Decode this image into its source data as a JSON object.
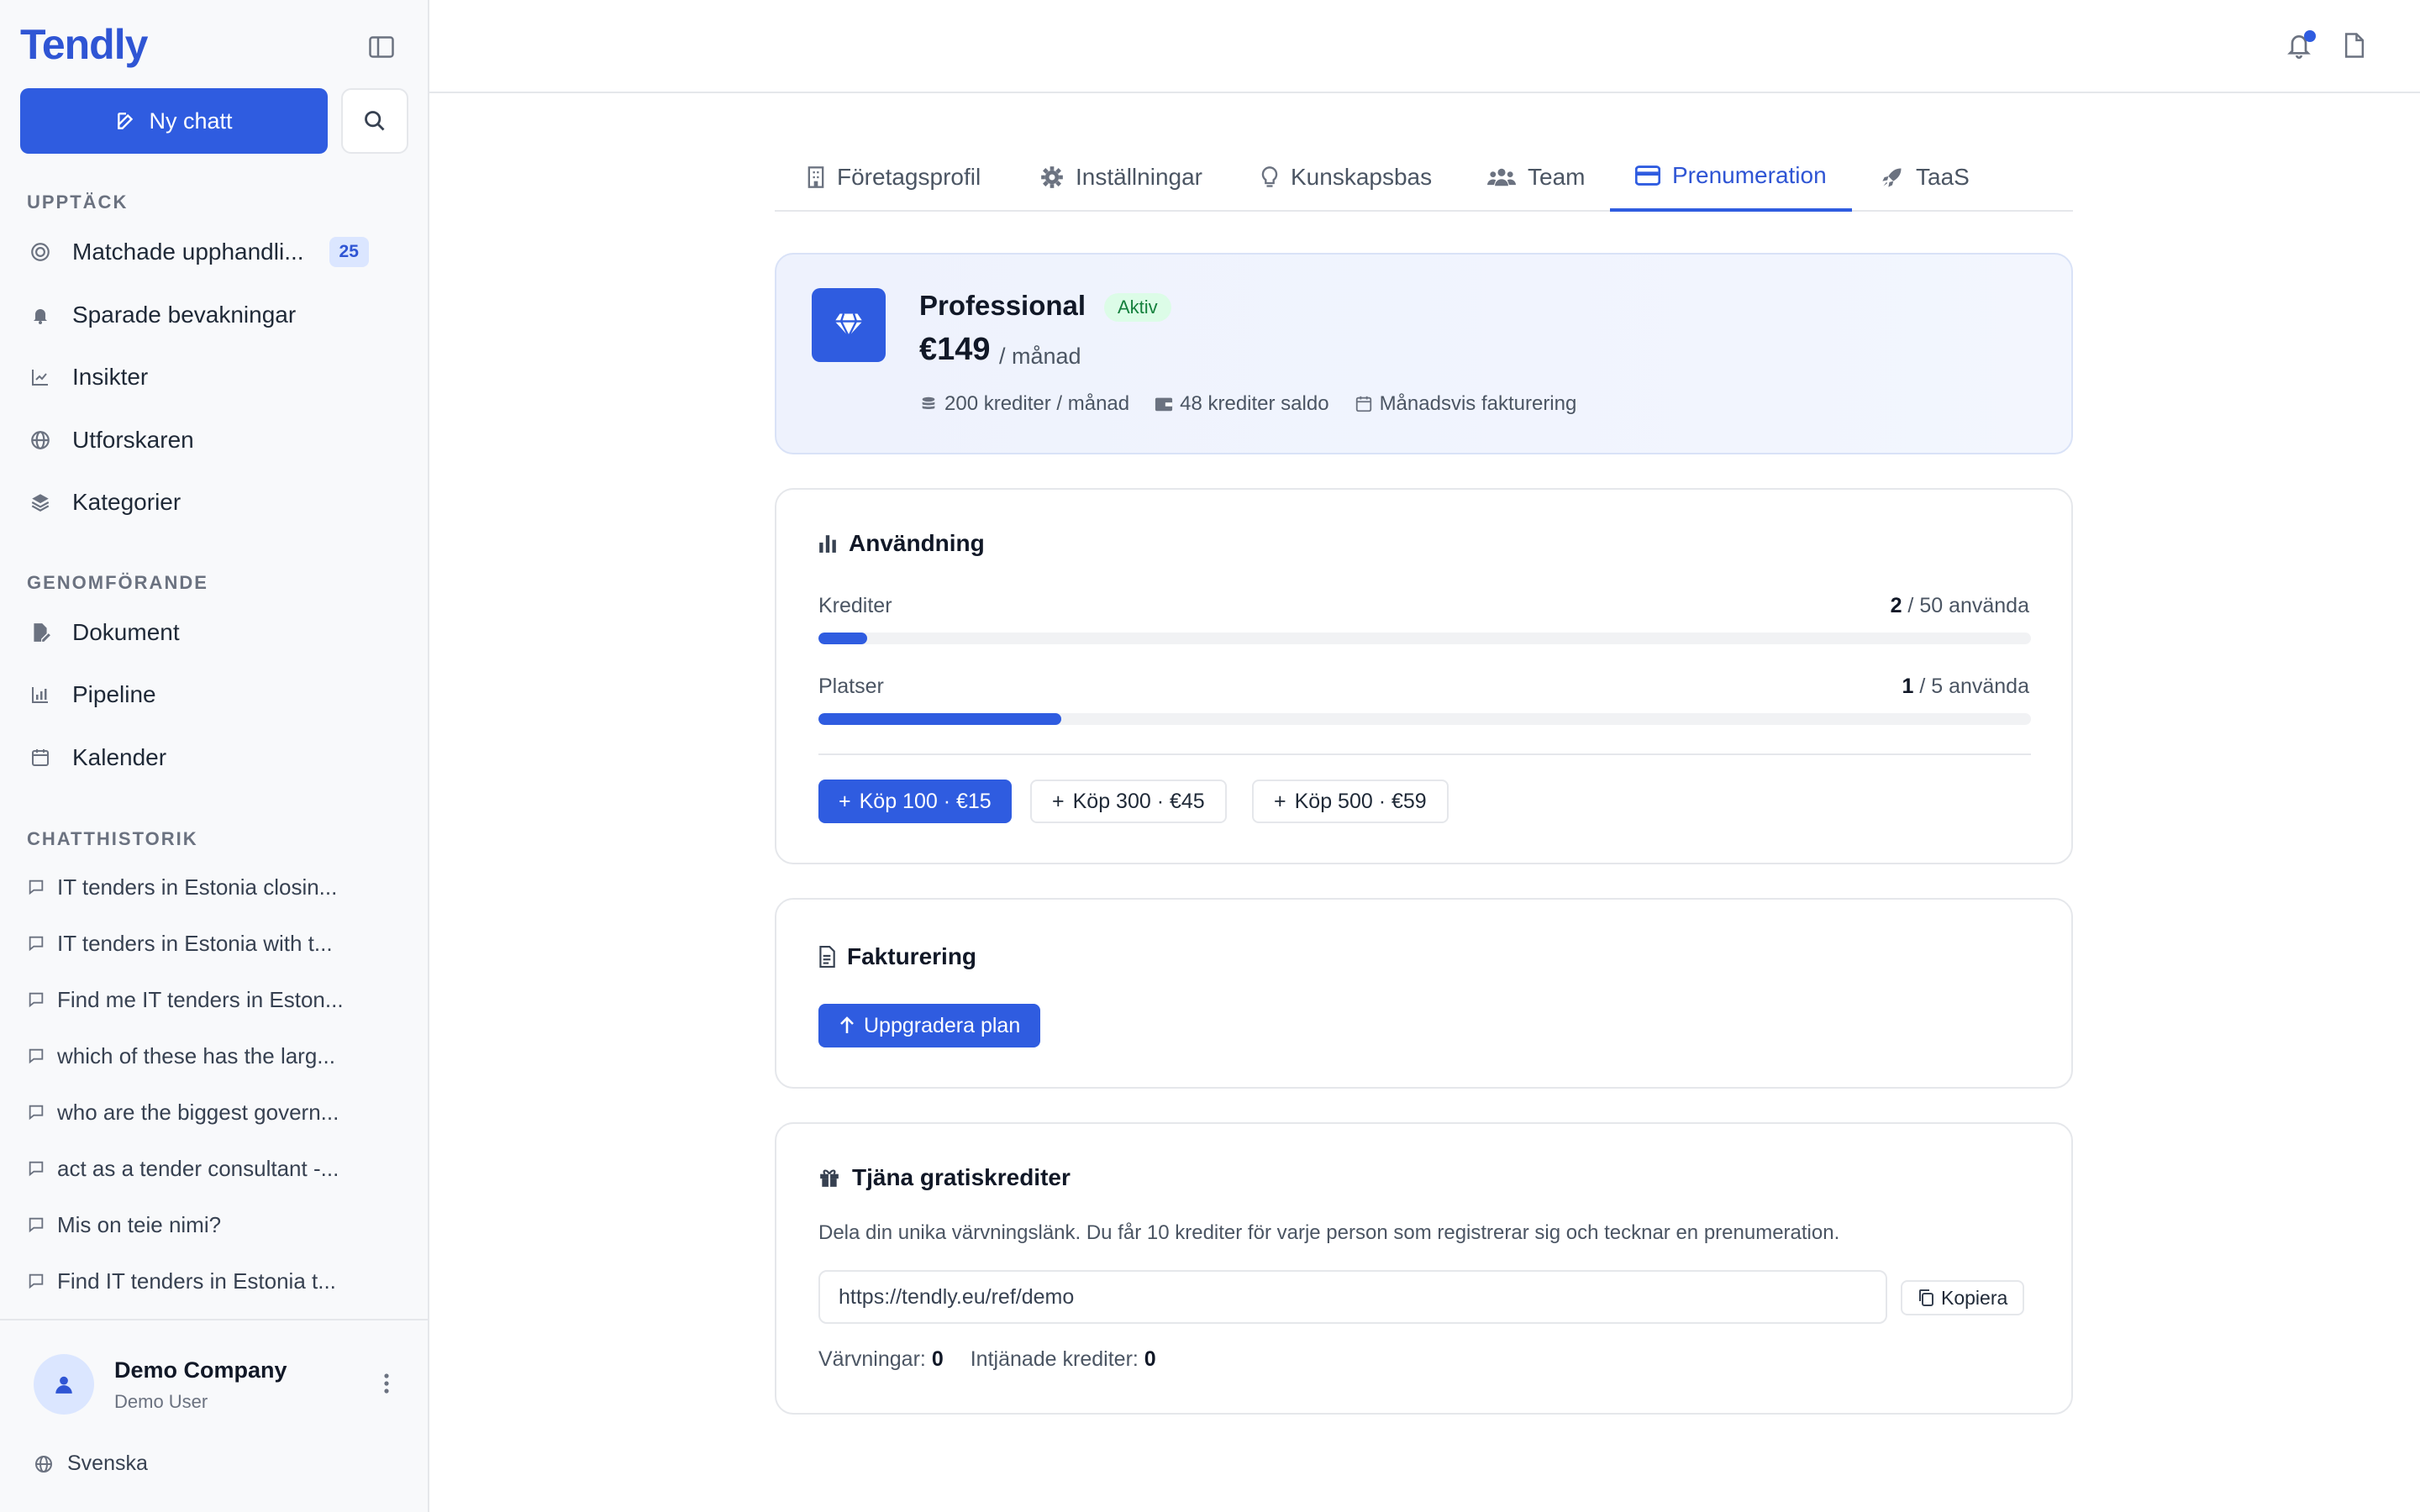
{
  "sidebar": {
    "logo": "Tendly",
    "new_chat": "Ny chatt",
    "sections": {
      "discover": "UPPTÄCK",
      "execution": "GENOMFÖRANDE",
      "history": "CHATTHISTORIK"
    },
    "discover_items": [
      {
        "label": "Matchade upphandli...",
        "badge": "25",
        "icon": "target-icon"
      },
      {
        "label": "Sparade bevakningar",
        "icon": "bell-icon"
      },
      {
        "label": "Insikter",
        "icon": "trend-chart-icon"
      },
      {
        "label": "Utforskaren",
        "icon": "globe-icon"
      },
      {
        "label": "Kategorier",
        "icon": "layers-icon"
      }
    ],
    "execution_items": [
      {
        "label": "Dokument",
        "icon": "document-edit-icon"
      },
      {
        "label": "Pipeline",
        "icon": "bar-chart-icon"
      },
      {
        "label": "Kalender",
        "icon": "calendar-icon"
      }
    ],
    "chats": [
      "IT tenders in Estonia closin...",
      "IT tenders in Estonia with t...",
      "Find me IT tenders in Eston...",
      "which of these has the larg...",
      "who are the biggest govern...",
      "act as a tender consultant -...",
      "Mis on teie nimi?",
      "Find IT tenders in Estonia t..."
    ],
    "account": {
      "company": "Demo Company",
      "user": "Demo User"
    },
    "language": "Svenska"
  },
  "tabs": [
    {
      "label": "Företagsprofil",
      "icon": "building-icon",
      "active": false
    },
    {
      "label": "Inställningar",
      "icon": "gear-icon",
      "active": false
    },
    {
      "label": "Kunskapsbas",
      "icon": "lightbulb-icon",
      "active": false
    },
    {
      "label": "Team",
      "icon": "users-icon",
      "active": false
    },
    {
      "label": "Prenumeration",
      "icon": "credit-card-icon",
      "active": true
    },
    {
      "label": "TaaS",
      "icon": "rocket-icon",
      "active": false
    }
  ],
  "plan": {
    "name": "Professional",
    "status": "Aktiv",
    "price": "€149",
    "period": "/ månad",
    "credits_month": "200 krediter / månad",
    "credits_balance": "48 krediter saldo",
    "billing": "Månadsvis fakturering"
  },
  "usage": {
    "title": "Användning",
    "credits_label": "Krediter",
    "credits_used": "2",
    "credits_total": "/ 50 använda",
    "credits_fraction": 0.04,
    "seats_label": "Platser",
    "seats_used": "1",
    "seats_total": "/ 5 använda",
    "seats_fraction": 0.2,
    "buy_buttons": [
      "Köp 100 · €15",
      "Köp 300 · €45",
      "Köp 500 · €59"
    ]
  },
  "billing": {
    "title": "Fakturering",
    "upgrade": "Uppgradera plan"
  },
  "referral": {
    "title": "Tjäna gratiskrediter",
    "description": "Dela din unika värvningslänk. Du får 10 krediter för varje person som registrerar sig och tecknar en prenumeration.",
    "link": "https://tendly.eu/ref/demo",
    "copy": "Kopiera",
    "referrals_label": "Värvningar:",
    "referrals_value": "0",
    "earned_label": "Intjänade krediter:",
    "earned_value": "0"
  },
  "colors": {
    "accent": "#2f5ce0",
    "success_bg": "#dcfce7",
    "success_text": "#15803d"
  }
}
